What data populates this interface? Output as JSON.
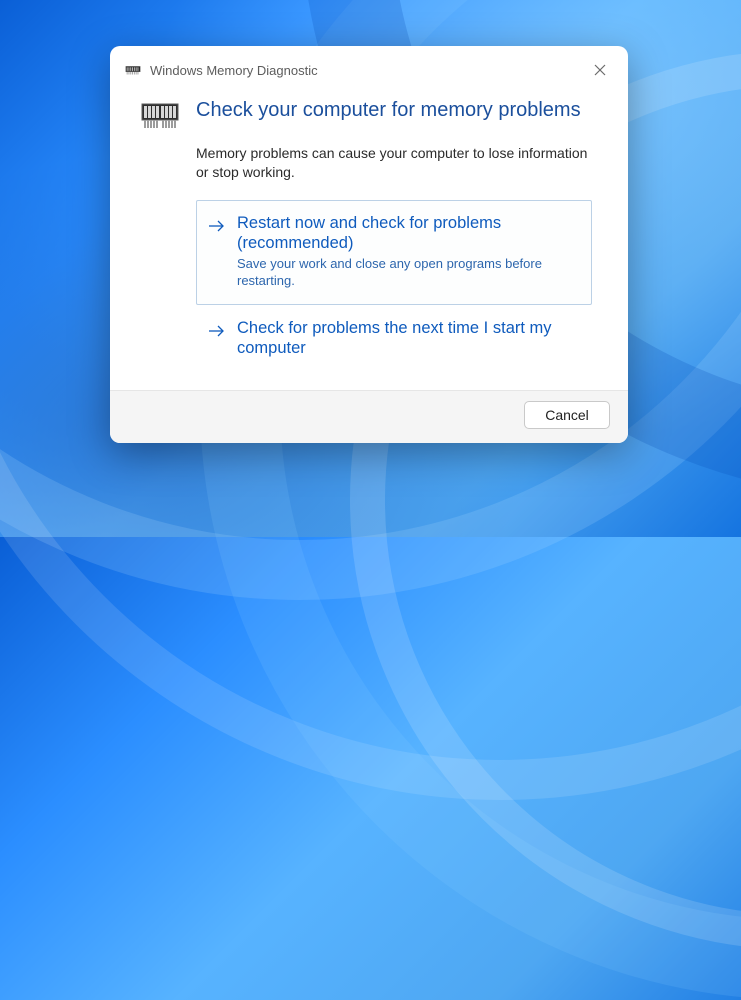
{
  "window": {
    "title": "Windows Memory Diagnostic"
  },
  "heading": "Check your computer for memory problems",
  "subtext": "Memory problems can cause your computer to lose information or stop working.",
  "options": {
    "restart_now": {
      "title": "Restart now and check for problems (recommended)",
      "desc": "Save your work and close any open programs before restarting."
    },
    "check_later": {
      "title": "Check for problems the next time I start my computer"
    }
  },
  "buttons": {
    "cancel": "Cancel"
  }
}
